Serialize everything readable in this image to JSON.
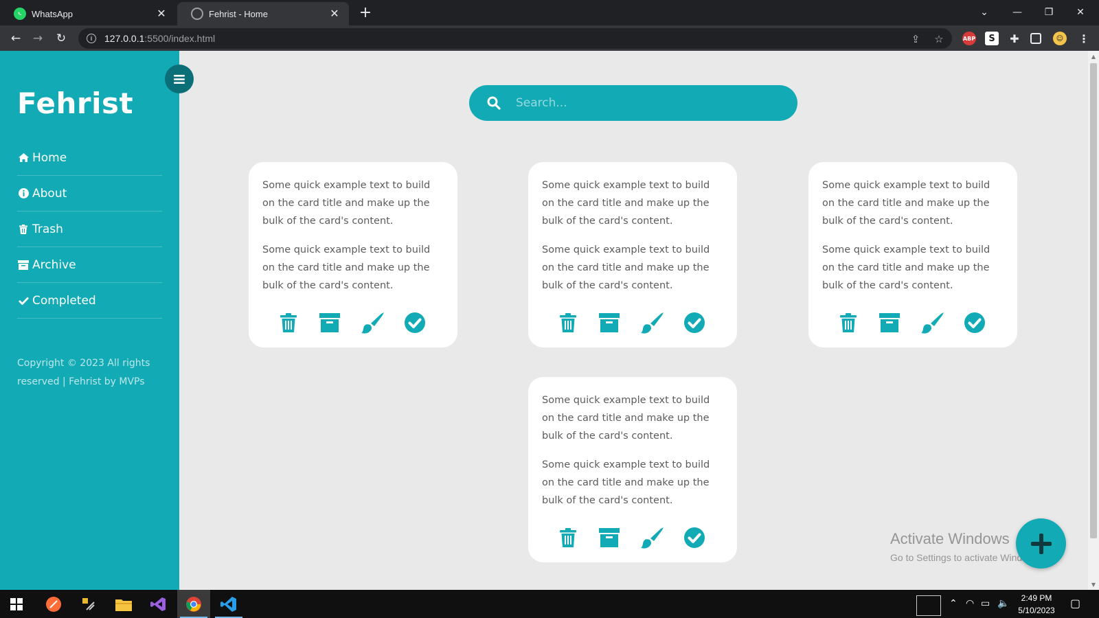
{
  "browser": {
    "tabs": [
      {
        "title": "WhatsApp"
      },
      {
        "title": "Fehrist - Home"
      }
    ],
    "url_host": "127.0.0.1",
    "url_path": ":5500/index.html"
  },
  "sidebar": {
    "brand": "Fehrist",
    "nav": [
      {
        "label": "Home",
        "icon": "home-icon"
      },
      {
        "label": "About",
        "icon": "info-icon"
      },
      {
        "label": "Trash",
        "icon": "trash-icon"
      },
      {
        "label": "Archive",
        "icon": "archive-icon"
      },
      {
        "label": "Completed",
        "icon": "check-icon"
      }
    ],
    "copyright": "Copyright © 2023 All rights reserved | Fehrist by MVPs"
  },
  "search": {
    "placeholder": "Search..."
  },
  "cards": [
    {
      "p1": "Some quick example text to build on the card title and make up the bulk of the card's content.",
      "p2": "Some quick example text to build on the card title and make up the bulk of the card's content."
    },
    {
      "p1": "Some quick example text to build on the card title and make up the bulk of the card's content.",
      "p2": "Some quick example text to build on the card title and make up the bulk of the card's content."
    },
    {
      "p1": "Some quick example text to build on the card title and make up the bulk of the card's content.",
      "p2": "Some quick example text to build on the card title and make up the bulk of the card's content."
    },
    {
      "p1": "Some quick example text to build on the card title and make up the bulk of the card's content.",
      "p2": "Some quick example text to build on the card title and make up the bulk of the card's content."
    }
  ],
  "card_actions": [
    "trash-icon",
    "archive-icon",
    "paint-brush-icon",
    "check-circle-icon"
  ],
  "watermark": {
    "line1": "Activate Windows",
    "line2": "Go to Settings to activate Windows."
  },
  "taskbar": {
    "time": "2:49 PM",
    "date": "5/10/2023"
  },
  "colors": {
    "accent": "#12aab5",
    "accent_dark": "#0b6f78",
    "page_bg": "#e9e9e9"
  }
}
